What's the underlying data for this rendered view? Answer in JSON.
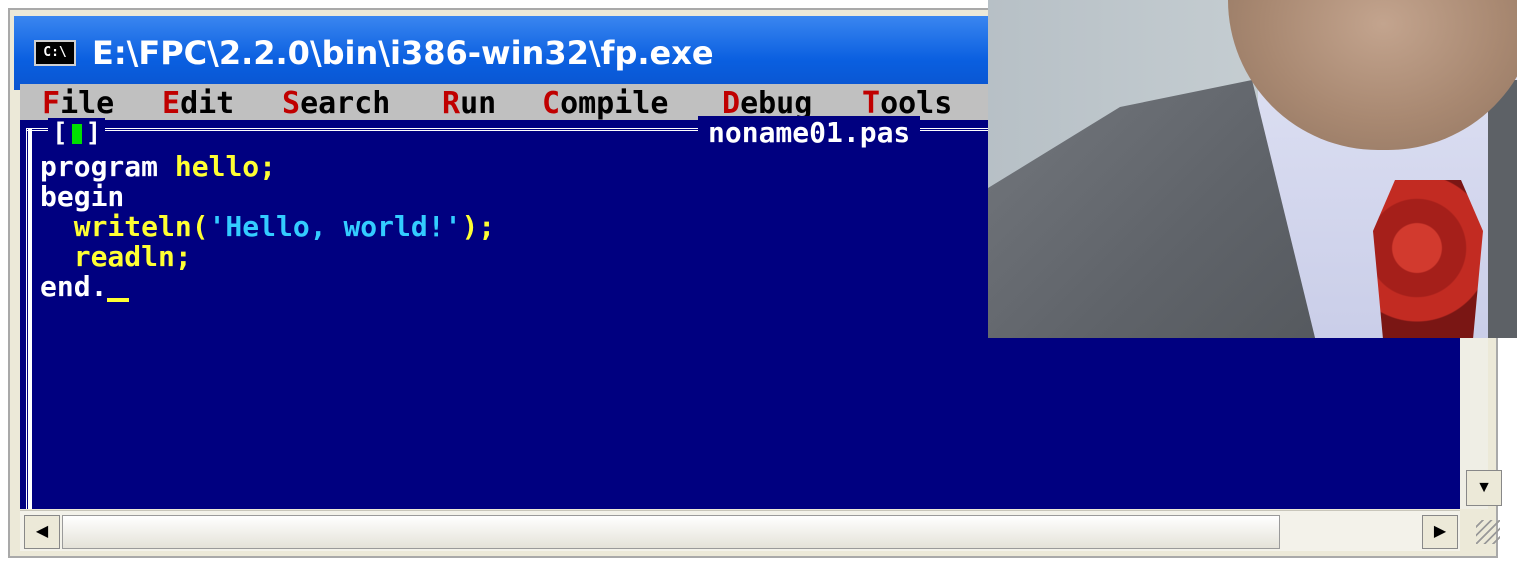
{
  "window": {
    "title": "E:\\FPC\\2.2.0\\bin\\i386-win32\\fp.exe",
    "icon_label": "C:\\"
  },
  "menu": [
    {
      "hotkey": "F",
      "rest": "ile"
    },
    {
      "hotkey": "E",
      "rest": "dit"
    },
    {
      "hotkey": "S",
      "rest": "earch"
    },
    {
      "hotkey": "R",
      "rest": "un"
    },
    {
      "hotkey": "C",
      "rest": "ompile"
    },
    {
      "hotkey": "D",
      "rest": "ebug"
    },
    {
      "hotkey": "T",
      "rest": "ools"
    }
  ],
  "editor": {
    "close_box_left": "[",
    "close_box_right": "]",
    "filename": "noname01.pas",
    "code": {
      "line1_kw": "program",
      "line1_id": " hello;",
      "line2": "begin",
      "line3_id": "  writeln(",
      "line3_str": "'Hello, world!'",
      "line3_end": ");",
      "line4_id": "  readln;",
      "line5": "end."
    }
  },
  "scroll": {
    "down_arrow": "▼",
    "left_arrow": "◀",
    "right_arrow": "▶"
  },
  "colors": {
    "console_bg": "#000080",
    "menu_bg": "#c0c0c0",
    "hotkey": "#c00000",
    "identifier": "#ffff33",
    "string": "#33ccff",
    "titlebar": "#0a5fe0"
  }
}
